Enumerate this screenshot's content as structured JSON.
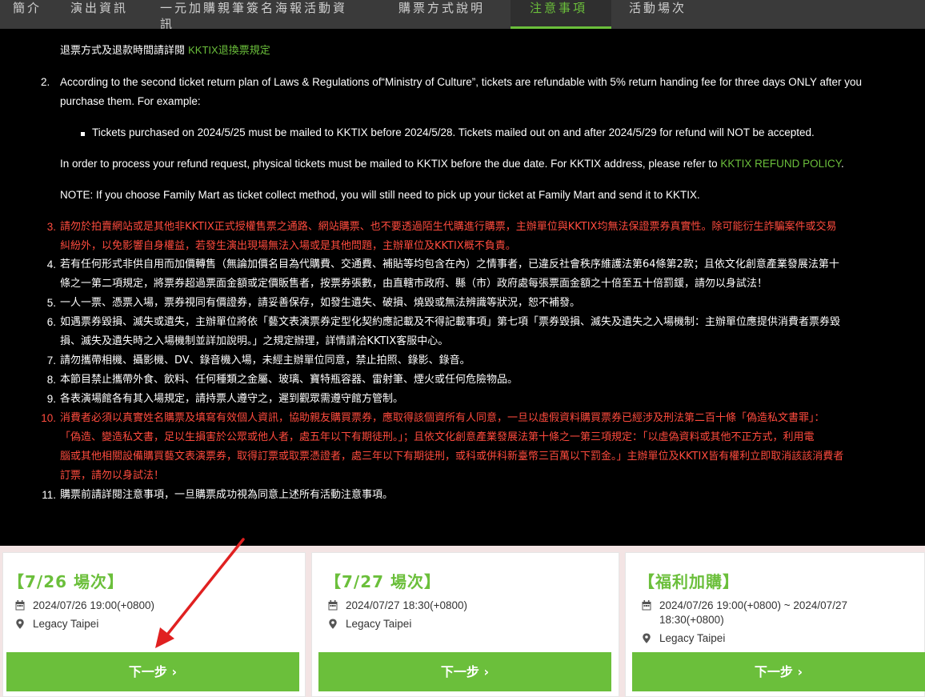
{
  "nav": {
    "tabs": [
      {
        "label": "簡介"
      },
      {
        "label": "演出資訊"
      },
      {
        "label": "一元加購親筆簽名海報活動資訊"
      },
      {
        "label": "購票方式說明"
      },
      {
        "label": "注意事項",
        "active": true
      },
      {
        "label": "活動場次"
      }
    ]
  },
  "notes": {
    "refund_prefix": "退票方式及退款時間請詳閱 ",
    "refund_link": "KKTIX退換票規定",
    "item2_num": "2.",
    "item2_line1": "According to the second ticket return plan of Laws & Regulations of“Ministry of Culture”,  tickets are refundable with 5% return handing fee for three days ONLY after you",
    "item2_line2": "purchase them. For example:",
    "bullet": "Tickets purchased on 2024/5/25 must be mailed to KKTIX before 2024/5/28. Tickets mailed out on and after 2024/5/29 for refund will NOT be accepted.",
    "process_text": "In order to process your refund request, physical tickets must be mailed to KKTIX before the due date. For KKTIX address, please refer to ",
    "process_link": "KKTIX REFUND POLICY",
    "process_end": ".",
    "note_text": "NOTE: If you choose Family Mart as ticket collect method, you will still need to pick up your ticket at Family Mart and send it to KKTIX.",
    "items": [
      {
        "num": "3.",
        "red": true,
        "lines": [
          "請勿於拍賣網站或是其他非KKTIX正式授權售票之通路、網站購票、也不要透過陌生代購進行購票，主辦單位與KKTIX均無法保證票券真實性。除可能衍生詐騙案件或交易",
          "糾紛外，以免影響自身權益，若發生演出現場無法入場或是其他問題，主辦單位及KKTIX概不負責。"
        ]
      },
      {
        "num": "4.",
        "red": false,
        "lines": [
          "若有任何形式非供自用而加價轉售（無論加價名目為代購費、交通費、補貼等均包含在內）之情事者，已違反社會秩序維護法第64條第2款；且依文化創意產業發展法第十",
          "條之一第二項規定，將票券超過票面金額或定價販售者，按票券張數，由直轄市政府、縣（市）政府處每張票面金額之十倍至五十倍罰鍰，請勿以身試法！"
        ]
      },
      {
        "num": "5.",
        "red": false,
        "lines": [
          "一人一票、憑票入場，票券視同有價證券，請妥善保存，如發生遺失、破損、燒毀或無法辨識等狀況，恕不補發。"
        ]
      },
      {
        "num": "6.",
        "red": false,
        "lines": [
          "如遇票券毀損、滅失或遺失，主辦單位將依「藝文表演票券定型化契約應記載及不得記載事項」第七項「票券毀損、滅失及遺失之入場機制：主辦單位應提供消費者票券毀",
          "損、滅失及遺失時之入場機制並詳加說明。」之規定辦理，詳情請洽KKTIX客服中心。"
        ]
      },
      {
        "num": "7.",
        "red": false,
        "lines": [
          "請勿攜帶相機、攝影機、DV、錄音機入場，未經主辦單位同意，禁止拍照、錄影、錄音。"
        ]
      },
      {
        "num": "8.",
        "red": false,
        "lines": [
          "本節目禁止攜帶外食、飲料、任何種類之金屬、玻璃、寶特瓶容器、雷射筆、煙火或任何危險物品。"
        ]
      },
      {
        "num": "9.",
        "red": false,
        "lines": [
          "各表演場館各有其入場規定，請持票人遵守之，遲到觀眾需遵守館方管制。"
        ]
      },
      {
        "num": "10.",
        "red": true,
        "lines": [
          "消費者必須以真實姓名購票及填寫有效個人資訊，協助親友購買票券，應取得該個資所有人同意，一旦以虛假資料購買票券已經涉及刑法第二百十條「偽造私文書罪」：",
          "「偽造、變造私文書，足以生損害於公眾或他人者，處五年以下有期徒刑。」；且依文化創意產業發展法第十條之一第三項規定：「以虛偽資料或其他不正方式，利用電",
          "腦或其他相關設備購買藝文表演票券，取得訂票或取票憑證者，處三年以下有期徒刑，或科或併科新臺幣三百萬以下罰金。」主辦單位及KKTIX皆有權利立即取消該該消費者",
          "訂票，請勿以身試法！"
        ]
      },
      {
        "num": "11.",
        "red": false,
        "lines": [
          "購票前請詳閱注意事項，一旦購票成功視為同意上述所有活動注意事項。"
        ]
      }
    ]
  },
  "sessions": [
    {
      "title": "【7/26 場次】",
      "datetime": "2024/07/26 19:00(+0800)",
      "datetime2": "",
      "venue": "Legacy Taipei",
      "button": "下一步 ›"
    },
    {
      "title": "【7/27 場次】",
      "datetime": "2024/07/27 18:30(+0800)",
      "datetime2": "",
      "venue": "Legacy Taipei",
      "button": "下一步 ›"
    },
    {
      "title": "【福利加購】",
      "datetime": "2024/07/26 19:00(+0800) ~ 2024/07/27",
      "datetime2": "18:30(+0800)",
      "venue": "Legacy Taipei",
      "button": "下一步 ›"
    }
  ],
  "colors": {
    "accent": "#6bbf3b",
    "warning": "#ff4b3e",
    "nav_bg": "#3a3a3a",
    "annotation": "#e02020"
  },
  "icons": {
    "calendar": "calendar-icon",
    "location": "map-pin-icon",
    "annotation": "annotation-arrow"
  }
}
